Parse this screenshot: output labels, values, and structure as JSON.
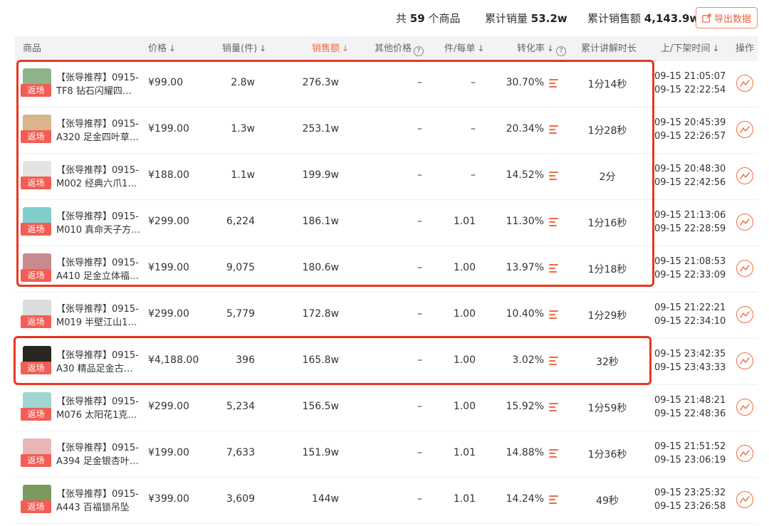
{
  "summary": {
    "total_prefix": "共",
    "total_count": "59",
    "total_suffix": "个商品",
    "sales_label": "累计销量",
    "sales_value": "53.2w",
    "revenue_label": "累计销售额",
    "revenue_value": "4,143.9w",
    "export_label": "导出数据"
  },
  "columns": {
    "product": "商品",
    "price": "价格",
    "volume": "销量(件)",
    "revenue": "销售额",
    "other_price": "其他价格",
    "per_order": "件/每单",
    "conversion": "转化率",
    "duration": "累计讲解时长",
    "onoff": "上/下架时间",
    "action": "操作"
  },
  "tag_label": "返场",
  "colors": {
    "accent": "#f26a3d",
    "tag": "#f25e55",
    "highlight": "#e8381f"
  },
  "rows": [
    {
      "name1": "【张导推荐】0915-",
      "name2": "TF8 钻石闪耀四…",
      "price": "¥99.00",
      "volume": "2.8w",
      "revenue": "276.3w",
      "other": "–",
      "per": "–",
      "conv": "30.70%",
      "dur": "1分14秒",
      "on": "09-15   21:05:07",
      "off": "09-15   22:22:54",
      "thumb": "#8fb38a"
    },
    {
      "name1": "【张导推荐】0915-",
      "name2": "A320 足金四叶草…",
      "price": "¥199.00",
      "volume": "1.3w",
      "revenue": "253.1w",
      "other": "–",
      "per": "–",
      "conv": "20.34%",
      "dur": "1分28秒",
      "on": "09-15   20:45:39",
      "off": "09-15   22:26:57",
      "thumb": "#d9b48c"
    },
    {
      "name1": "【张导推荐】0915-",
      "name2": "M002 经典六爪1…",
      "price": "¥188.00",
      "volume": "1.1w",
      "revenue": "199.9w",
      "other": "–",
      "per": "–",
      "conv": "14.52%",
      "dur": "2分",
      "on": "09-15   20:48:30",
      "off": "09-15   22:42:56",
      "thumb": "#e4e4e4"
    },
    {
      "name1": "【张导推荐】0915-",
      "name2": "M010 真命天子方…",
      "price": "¥299.00",
      "volume": "6,224",
      "revenue": "186.1w",
      "other": "–",
      "per": "1.01",
      "conv": "11.30%",
      "dur": "1分16秒",
      "on": "09-15   21:13:06",
      "off": "09-15   22:28:59",
      "thumb": "#7fd0cc"
    },
    {
      "name1": "【张导推荐】0915-",
      "name2": "A410 足金立体福…",
      "price": "¥199.00",
      "volume": "9,075",
      "revenue": "180.6w",
      "other": "–",
      "per": "1.00",
      "conv": "13.97%",
      "dur": "1分18秒",
      "on": "09-15   21:08:53",
      "off": "09-15   22:33:09",
      "thumb": "#c98a8e"
    },
    {
      "name1": "【张导推荐】0915-",
      "name2": "M019 半壁江山1…",
      "price": "¥299.00",
      "volume": "5,779",
      "revenue": "172.8w",
      "other": "–",
      "per": "1.00",
      "conv": "10.40%",
      "dur": "1分29秒",
      "on": "09-15   21:22:21",
      "off": "09-15   22:34:10",
      "thumb": "#dcdcdc"
    },
    {
      "name1": "【张导推荐】0915-",
      "name2": "A30 精品足金古…",
      "price": "¥4,188.00",
      "volume": "396",
      "revenue": "165.8w",
      "other": "–",
      "per": "1.00",
      "conv": "3.02%",
      "dur": "32秒",
      "on": "09-15   23:42:35",
      "off": "09-15   23:43:33",
      "thumb": "#2a2622"
    },
    {
      "name1": "【张导推荐】0915-",
      "name2": "M076 太阳花1克…",
      "price": "¥299.00",
      "volume": "5,234",
      "revenue": "156.5w",
      "other": "–",
      "per": "1.00",
      "conv": "15.92%",
      "dur": "1分59秒",
      "on": "09-15   21:48:21",
      "off": "09-15   22:48:36",
      "thumb": "#9fd6d2"
    },
    {
      "name1": "【张导推荐】0915-",
      "name2": "A394 足金银杏叶…",
      "price": "¥199.00",
      "volume": "7,633",
      "revenue": "151.9w",
      "other": "–",
      "per": "1.01",
      "conv": "14.88%",
      "dur": "1分36秒",
      "on": "09-15   21:51:52",
      "off": "09-15   23:06:19",
      "thumb": "#e9b6b8"
    },
    {
      "name1": "【张导推荐】0915-",
      "name2": "A443 百福锁吊坠",
      "price": "¥399.00",
      "volume": "3,609",
      "revenue": "144w",
      "other": "–",
      "per": "1.01",
      "conv": "14.24%",
      "dur": "49秒",
      "on": "09-15   23:25:32",
      "off": "09-15   23:26:58",
      "thumb": "#7d9a5e"
    }
  ]
}
